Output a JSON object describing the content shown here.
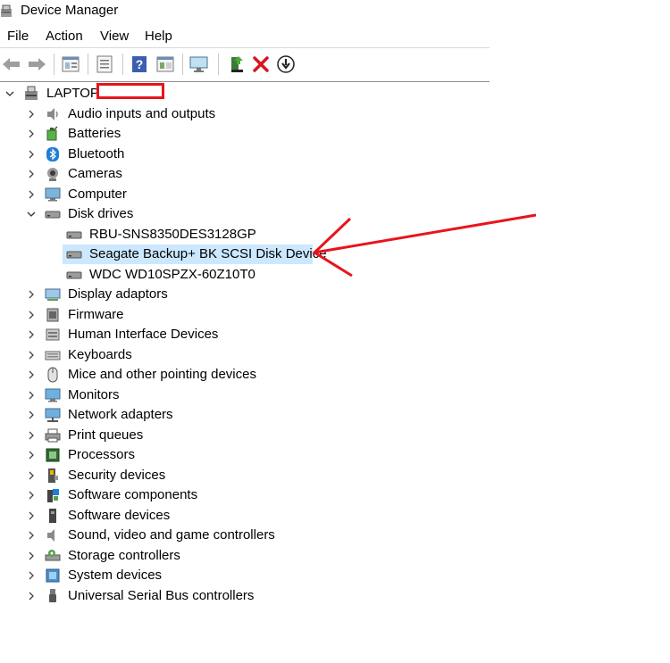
{
  "window": {
    "title": "Device Manager"
  },
  "menu": [
    "File",
    "Action",
    "View",
    "Help"
  ],
  "toolbar": [
    "back-icon",
    "forward-icon",
    "properties-icon",
    "console-tree-icon",
    "help-icon",
    "show-hide-icon",
    "monitor-scan-icon",
    "update-driver-icon",
    "uninstall-icon",
    "download-icon"
  ],
  "tree": {
    "root": "LAPTOP-",
    "categories": [
      {
        "label": "Audio inputs and outputs",
        "icon": "speaker-icon"
      },
      {
        "label": "Batteries",
        "icon": "battery-icon"
      },
      {
        "label": "Bluetooth",
        "icon": "bluetooth-icon"
      },
      {
        "label": "Cameras",
        "icon": "camera-icon"
      },
      {
        "label": "Computer",
        "icon": "computer-icon"
      },
      {
        "label": "Disk drives",
        "icon": "disk-drive-icon",
        "expanded": true,
        "children": [
          "RBU-SNS8350DES3128GP",
          "Seagate Backup+  BK SCSI Disk Device",
          "WDC WD10SPZX-60Z10T0"
        ]
      },
      {
        "label": "Display adaptors",
        "icon": "display-adaptor-icon"
      },
      {
        "label": "Firmware",
        "icon": "firmware-icon"
      },
      {
        "label": "Human Interface Devices",
        "icon": "hid-icon"
      },
      {
        "label": "Keyboards",
        "icon": "keyboard-icon"
      },
      {
        "label": "Mice and other pointing devices",
        "icon": "mouse-icon"
      },
      {
        "label": "Monitors",
        "icon": "monitor-icon"
      },
      {
        "label": "Network adapters",
        "icon": "network-adapter-icon"
      },
      {
        "label": "Print queues",
        "icon": "printer-icon"
      },
      {
        "label": "Processors",
        "icon": "processor-icon"
      },
      {
        "label": "Security devices",
        "icon": "security-device-icon"
      },
      {
        "label": "Software components",
        "icon": "software-component-icon"
      },
      {
        "label": "Software devices",
        "icon": "software-device-icon"
      },
      {
        "label": "Sound, video and game controllers",
        "icon": "sound-controller-icon"
      },
      {
        "label": "Storage controllers",
        "icon": "storage-controller-icon"
      },
      {
        "label": "System devices",
        "icon": "system-device-icon"
      },
      {
        "label": "Universal Serial Bus controllers",
        "icon": "usb-icon"
      }
    ],
    "selected": "Seagate Backup+  BK SCSI Disk Device"
  },
  "colors": {
    "selection": "#cce8ff",
    "annotation": "#e8141b"
  }
}
